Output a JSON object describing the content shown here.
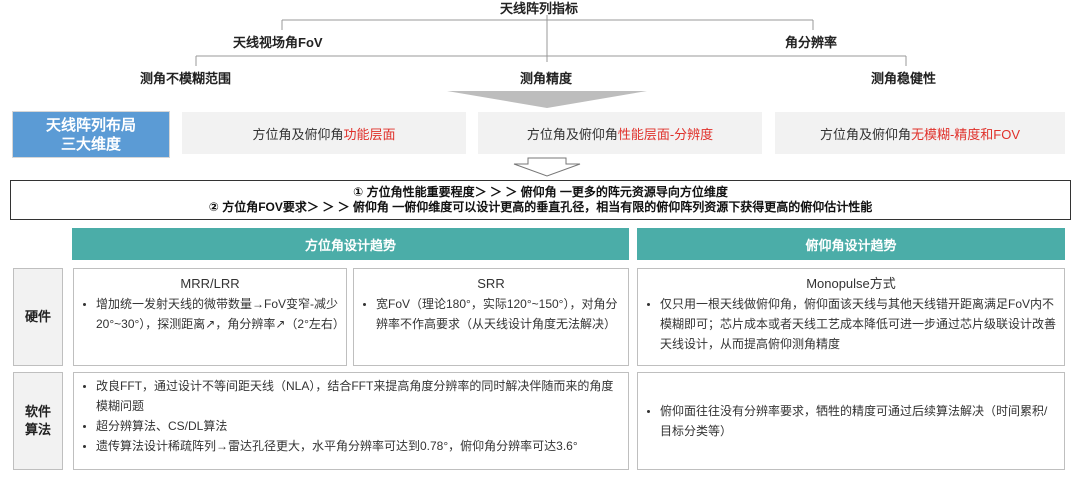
{
  "tree": {
    "root": "天线阵列指标",
    "left": "天线视场角FoV",
    "right": "角分辨率",
    "leaf1": "测角不模糊范围",
    "leaf2": "测角精度",
    "leaf3": "测角稳健性"
  },
  "dimensions": {
    "label_line1": "天线阵列布局",
    "label_line2": "三大维度",
    "items": [
      {
        "prefix": "方位角及俯仰角",
        "highlight": "功能层面"
      },
      {
        "prefix": "方位角及俯仰角",
        "highlight": "性能层面-分辨度"
      },
      {
        "prefix": "方位角及俯仰角",
        "highlight": "无模糊-精度和FOV"
      }
    ]
  },
  "summary": {
    "line1": "① 方位角性能重要程度＞ ＞ ＞ 俯仰角 一更多的阵元资源导向方位维度",
    "line2": "② 方位角FOV要求＞ ＞ ＞ 俯仰角 一俯仰维度可以设计更高的垂直孔径，相当有限的俯仰阵列资源下获得更高的俯仰估计性能"
  },
  "headers": {
    "azimuth": "方位角设计趋势",
    "elevation": "俯仰角设计趋势"
  },
  "rows": {
    "hardware": "硬件",
    "software_line1": "软件",
    "software_line2": "算法"
  },
  "hardware": {
    "mrr": {
      "title": "MRR/LRR",
      "bullets": [
        "增加统一发射天线的微带数量→FoV变窄-减少20°~30°），探测距离↗，角分辨率↗（2°左右）"
      ]
    },
    "srr": {
      "title": "SRR",
      "bullets": [
        "宽FoV（理论180°，实际120°~150°），对角分辨率不作高要求（从天线设计角度无法解决）"
      ]
    },
    "mono": {
      "title": "Monopulse方式",
      "bullets": [
        "仅只用一根天线做俯仰角，俯仰面该天线与其他天线错开距离满足FoV内不模糊即可；芯片成本或者天线工艺成本降低可进一步通过芯片级联设计改善天线设计，从而提高俯仰测角精度"
      ]
    }
  },
  "software": {
    "azimuth_bullets": [
      "改良FFT，通过设计不等间距天线（NLA），结合FFT来提高角度分辨率的同时解决伴随而来的角度模糊问题",
      "超分辨算法、CS/DL算法",
      "遗传算法设计稀疏阵列→雷达孔径更大，水平角分辨率可达到0.78°，俯仰角分辨率可达3.6°"
    ],
    "elevation_bullets": [
      "俯仰面往往没有分辨率要求，牺牲的精度可通过后续算法解决（时间累积/目标分类等）"
    ]
  },
  "colors": {
    "blue": "#5b9bd5",
    "teal": "#4bada8",
    "red": "#e0312b",
    "grey": "#f2f2f2"
  }
}
